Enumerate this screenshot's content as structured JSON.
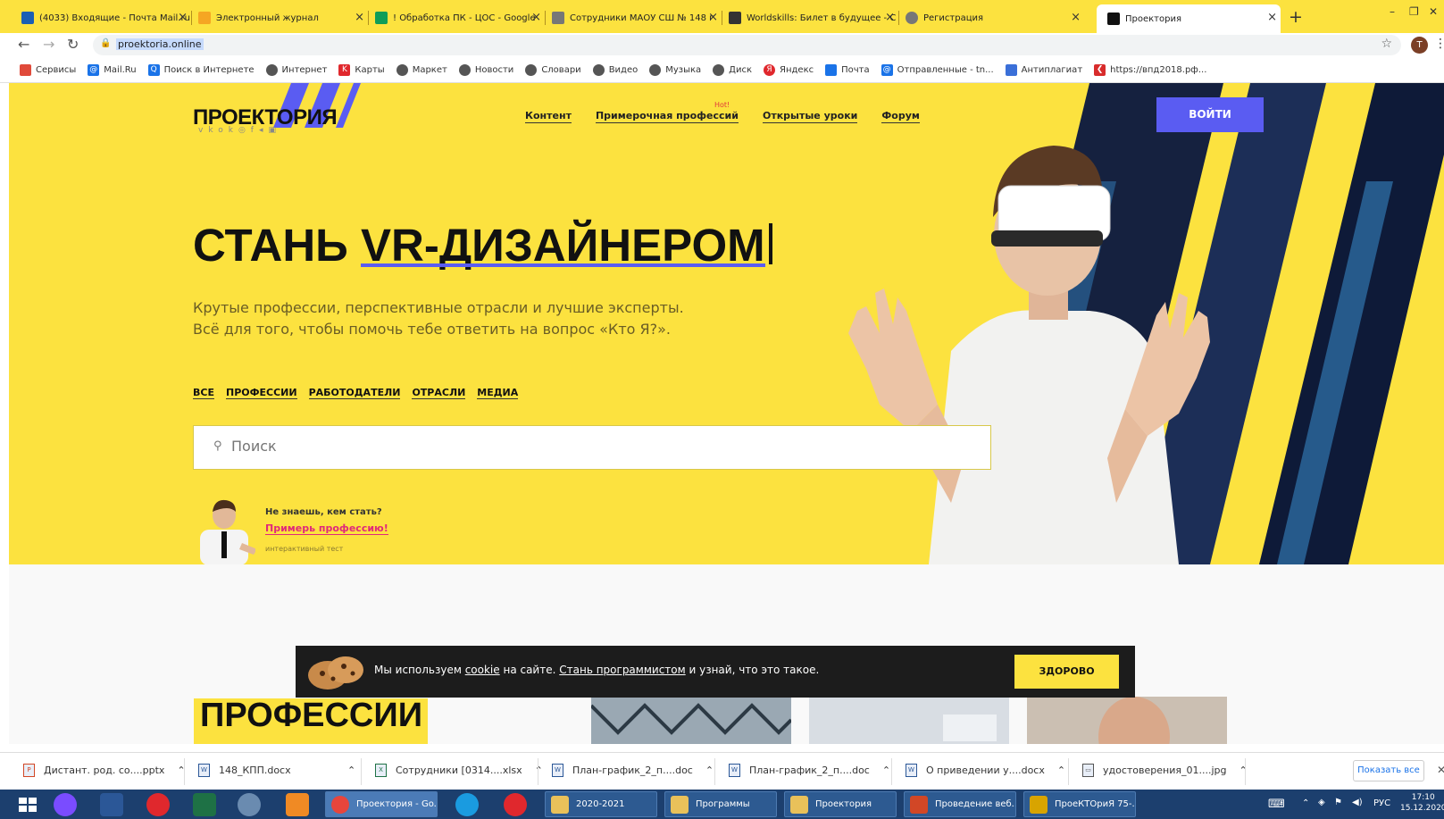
{
  "browser": {
    "tabs": [
      {
        "title": "(4033) Входящие - Почта Mail.ru",
        "color": "#1a5fb4"
      },
      {
        "title": "Электронный журнал",
        "color": "#f5a623"
      },
      {
        "title": "! Обработка ПК - ЦОС - Google",
        "color": "#0f9d58"
      },
      {
        "title": "Сотрудники МАОУ СШ № 148 г",
        "color": "#333333"
      },
      {
        "title": "Worldskills: Билет в будущее - С",
        "color": "#333333"
      },
      {
        "title": "Регистрация",
        "color": "#555555"
      },
      {
        "title": "Проектория",
        "color": "#111111"
      }
    ],
    "new_tab": "+",
    "url": "proektoria.online",
    "profile_initial": "T",
    "bookmarks": [
      {
        "label": "Сервисы",
        "icon": "apps-icon",
        "color": "#e04a3a"
      },
      {
        "label": "Mail.Ru",
        "icon": "mailru-icon",
        "color": "#1a73e8"
      },
      {
        "label": "Поиск в Интернете",
        "icon": "search-icon",
        "color": "#1a73e8"
      },
      {
        "label": "Интернет",
        "icon": "globe-icon",
        "color": "#555555"
      },
      {
        "label": "Карты",
        "icon": "maps-icon",
        "color": "#e0282d"
      },
      {
        "label": "Маркет",
        "icon": "globe-icon",
        "color": "#555555"
      },
      {
        "label": "Новости",
        "icon": "globe-icon",
        "color": "#555555"
      },
      {
        "label": "Словари",
        "icon": "globe-icon",
        "color": "#555555"
      },
      {
        "label": "Видео",
        "icon": "globe-icon",
        "color": "#555555"
      },
      {
        "label": "Музыка",
        "icon": "globe-icon",
        "color": "#555555"
      },
      {
        "label": "Диск",
        "icon": "globe-icon",
        "color": "#555555"
      },
      {
        "label": "Яндекс",
        "icon": "yandex-icon",
        "color": "#e0282d"
      },
      {
        "label": "Почта",
        "icon": "mail-icon",
        "color": "#1a73e8"
      },
      {
        "label": "Отправленные - tn...",
        "icon": "mailru-icon",
        "color": "#1a73e8"
      },
      {
        "label": "Антиплагиат",
        "icon": "shield-icon",
        "color": "#3a6fd8"
      },
      {
        "label": "https://впд2018.рф...",
        "icon": "bookmark-icon",
        "color": "#d82c2c"
      }
    ]
  },
  "site": {
    "logo": "ПРОЕКТОРИЯ",
    "nav": [
      "Контент",
      "Примерочная профессий",
      "Открытые уроки",
      "Форум"
    ],
    "hot_badge": "Hot!",
    "login": "ВОЙТИ",
    "headline_prefix": "СТАНЬ ",
    "headline_highlight": "VR-ДИЗАЙНЕРОМ",
    "subtitle_line1": "Крутые профессии, перспективные отрасли и лучшие эксперты.",
    "subtitle_line2": "Всё для того, чтобы помочь тебе ответить на вопрос «Кто Я?».",
    "filters": [
      "ВСЕ",
      "ПРОФЕССИИ",
      "РАБОТОДАТЕЛИ",
      "ОТРАСЛИ",
      "МЕДИА"
    ],
    "search_placeholder": "Поиск",
    "promo_question": "Не знаешь, кем стать?",
    "promo_link": "Примерь профессию!",
    "promo_note": "интерактивный тест",
    "section_title": "ПРОФЕССИИ",
    "cookie": {
      "text_before": "Мы используем ",
      "link1": "cookie",
      "text_mid": " на сайте. ",
      "link2": "Стань программистом",
      "text_after": " и узнай, что это такое.",
      "button": "ЗДОРОВО"
    },
    "accent_yellow": "#fce23f",
    "accent_blue": "#5a5cf2"
  },
  "downloads": {
    "items": [
      "Дистант. род. со....pptx",
      "148_КПП.docx",
      "Сотрудники [0314....xlsx",
      "План-график_2_п....doc",
      "План-график_2_п....doc",
      "О приведении у....docx",
      "удостоверения_01....jpg"
    ],
    "show_all": "Показать все"
  },
  "taskbar": {
    "buttons": [
      {
        "label": "Проектория - Go...",
        "color": "#e8453c"
      },
      {
        "label": "2020-2021",
        "color": "#e9c15a"
      },
      {
        "label": "Программы",
        "color": "#e9c15a"
      },
      {
        "label": "Проектория",
        "color": "#e9c15a"
      },
      {
        "label": "Проведение веб...",
        "color": "#d24726"
      },
      {
        "label": "ПроеКТОриЯ 75-...",
        "color": "#d8a400"
      }
    ],
    "language": "РУС",
    "time": "17:10",
    "date": "15.12.2020"
  }
}
